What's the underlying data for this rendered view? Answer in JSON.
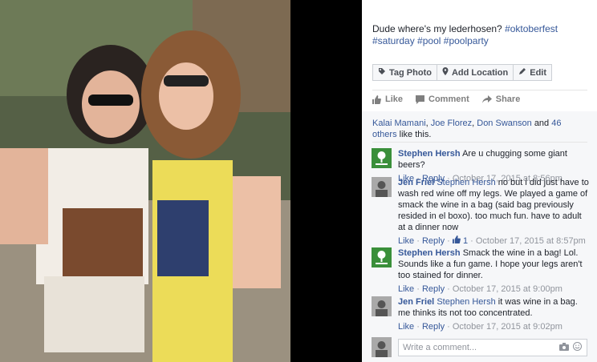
{
  "caption": {
    "text": "Dude where's my lederhosen?",
    "hashtags": [
      "#oktoberfest",
      "#saturday",
      "#pool",
      "#poolparty"
    ]
  },
  "actions": {
    "tag_photo": "Tag Photo",
    "add_location": "Add Location",
    "edit": "Edit"
  },
  "likebar": {
    "like": "Like",
    "comment": "Comment",
    "share": "Share"
  },
  "reactions": {
    "names": [
      "Kalai Mamani",
      "Joe Florez",
      "Don Swanson"
    ],
    "and": "and",
    "others": "46 others",
    "tail": "like this."
  },
  "comments": [
    {
      "author": "Stephen Hersh",
      "text": "Are u chugging some giant beers?",
      "like": "Like",
      "reply": "Reply",
      "time": "October 17, 2015 at 8:56pm",
      "avatar": "green-logo"
    },
    {
      "author": "Jen Friel",
      "mention": "Stephen Hersh",
      "text": "no but i did just have to wash red wine off my legs. We played a game of smack the wine in a bag (said bag previously resided in el boxo). too much fun. have to adult at a dinner now",
      "like": "Like",
      "reply": "Reply",
      "likes": "1",
      "time": "October 17, 2015 at 8:57pm",
      "avatar": "photo"
    },
    {
      "author": "Stephen Hersh",
      "text": "Smack the wine in a bag! Lol. Sounds like a fun game. I hope your legs aren't too stained for dinner.",
      "like": "Like",
      "reply": "Reply",
      "time": "October 17, 2015 at 9:00pm",
      "avatar": "green-logo"
    },
    {
      "author": "Jen Friel",
      "mention": "Stephen Hersh",
      "text": "it was wine in a bag. me thinks its not too concentrated.",
      "like": "Like",
      "reply": "Reply",
      "time": "October 17, 2015 at 9:02pm",
      "avatar": "photo"
    }
  ],
  "composer": {
    "placeholder": "Write a comment..."
  },
  "colors": {
    "link": "#365899",
    "meta": "#90949c",
    "avatar_green": "#3a8f3a"
  }
}
